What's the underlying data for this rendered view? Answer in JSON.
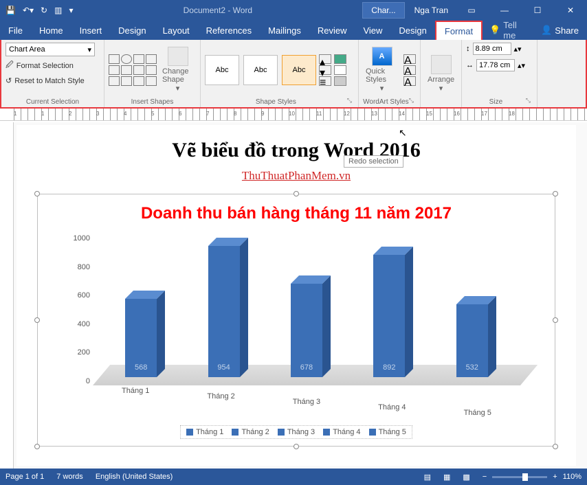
{
  "titlebar": {
    "doc_title": "Document2 - Word",
    "context_tab": "Char...",
    "user": "Nga Tran"
  },
  "menubar": {
    "tabs": [
      "File",
      "Home",
      "Insert",
      "Design",
      "Layout",
      "References",
      "Mailings",
      "Review",
      "View",
      "Design",
      "Format"
    ],
    "tellme": "Tell me",
    "share": "Share"
  },
  "ribbon": {
    "current_selection": {
      "dropdown": "Chart Area",
      "format_selection": "Format Selection",
      "reset": "Reset to Match Style",
      "label": "Current Selection"
    },
    "insert_shapes": {
      "change_shape": "Change Shape",
      "label": "Insert Shapes"
    },
    "shape_styles": {
      "abc": "Abc",
      "label": "Shape Styles"
    },
    "wordart": {
      "quick_styles": "Quick Styles",
      "label": "WordArt Styles"
    },
    "arrange": {
      "arrange": "Arrange",
      "label": ""
    },
    "size": {
      "height": "8.89 cm",
      "width": "17.78 cm",
      "label": "Size"
    }
  },
  "document": {
    "heading": "Vẽ biểu đồ trong Word 2016",
    "link": "ThuThuatPhanMem.vn",
    "tooltip": "Redo selection"
  },
  "chart_data": {
    "type": "bar",
    "title": "Doanh thu bán hàng tháng 11 năm 2017",
    "categories": [
      "Tháng 1",
      "Tháng 2",
      "Tháng 3",
      "Tháng 4",
      "Tháng 5"
    ],
    "values": [
      568,
      954,
      678,
      892,
      532
    ],
    "ylim": [
      0,
      1000
    ],
    "yticks": [
      0,
      200,
      400,
      600,
      800,
      1000
    ],
    "legend": [
      "Tháng 1",
      "Tháng 2",
      "Tháng 3",
      "Tháng 4",
      "Tháng 5"
    ]
  },
  "statusbar": {
    "page": "Page 1 of 1",
    "words": "7 words",
    "lang": "English (United States)",
    "zoom": "110%"
  }
}
